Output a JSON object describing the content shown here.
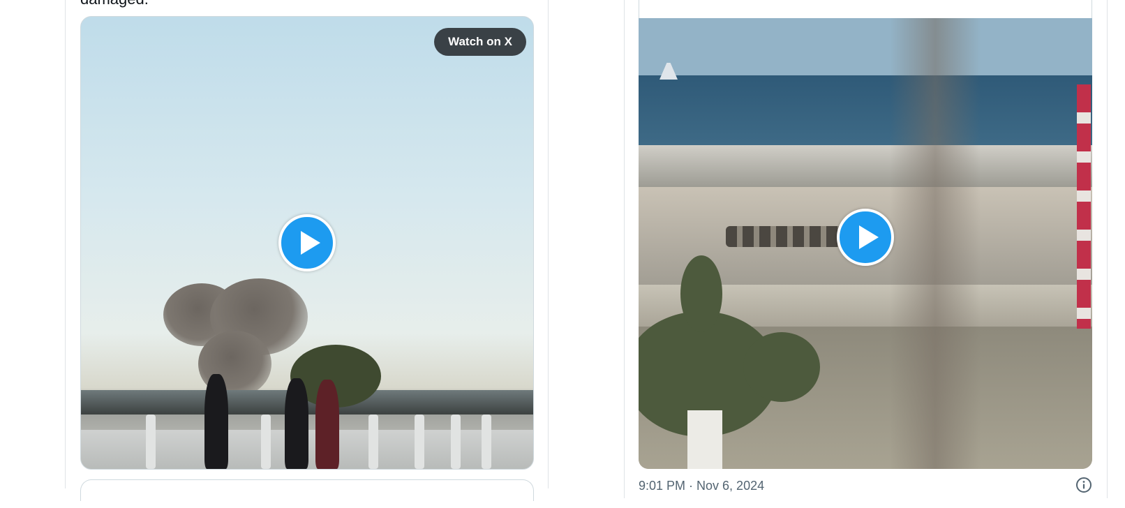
{
  "left_tweet": {
    "cut_text": "damaged.",
    "watch_label": "Watch on X",
    "video_play_icon": "play-icon"
  },
  "right_tweet": {
    "video_play_icon": "play-icon",
    "timestamp": "9:01 PM · Nov 6, 2024",
    "info_icon": "info-icon"
  },
  "colors": {
    "accent_blue": "#1d9bf0",
    "muted_text": "#536471",
    "border": "#cfd9de"
  }
}
